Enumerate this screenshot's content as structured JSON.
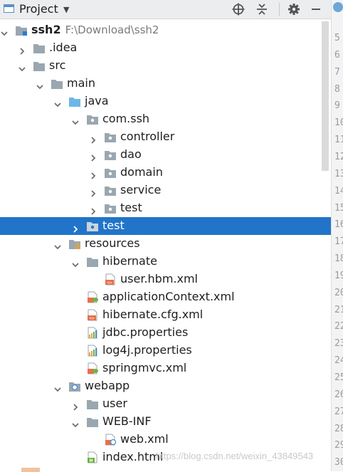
{
  "header": {
    "title": "Project",
    "icons": [
      "project-view-icon",
      "dropdown-icon",
      "locate-icon",
      "collapse-all-icon",
      "gear-icon"
    ]
  },
  "gutter": {
    "line_numbers": [
      "5",
      "6",
      "7",
      "8",
      "9",
      "10",
      "11",
      "12",
      "13",
      "14",
      "15",
      "16",
      "17",
      "18",
      "19",
      "20",
      "21",
      "22",
      "23",
      "24",
      "25",
      "26",
      "27",
      "28",
      "29",
      "30"
    ]
  },
  "tree": [
    {
      "depth": 0,
      "arrow": "down",
      "icon": "module",
      "label": "ssh2",
      "extra": "F:\\Download\\ssh2",
      "bold": true
    },
    {
      "depth": 1,
      "arrow": "right",
      "icon": "folder-gray",
      "label": ".idea"
    },
    {
      "depth": 1,
      "arrow": "down",
      "icon": "folder-gray",
      "label": "src"
    },
    {
      "depth": 2,
      "arrow": "down",
      "icon": "folder-gray",
      "label": "main"
    },
    {
      "depth": 3,
      "arrow": "down",
      "icon": "folder-blue",
      "label": "java"
    },
    {
      "depth": 4,
      "arrow": "down",
      "icon": "package",
      "label": "com.ssh"
    },
    {
      "depth": 5,
      "arrow": "right",
      "icon": "package",
      "label": "controller"
    },
    {
      "depth": 5,
      "arrow": "right",
      "icon": "package",
      "label": "dao"
    },
    {
      "depth": 5,
      "arrow": "right",
      "icon": "package",
      "label": "domain"
    },
    {
      "depth": 5,
      "arrow": "right",
      "icon": "package",
      "label": "service"
    },
    {
      "depth": 5,
      "arrow": "right",
      "icon": "package",
      "label": "test"
    },
    {
      "depth": 4,
      "arrow": "right",
      "icon": "package",
      "label": "test",
      "selected": true
    },
    {
      "depth": 3,
      "arrow": "down",
      "icon": "folder-resources",
      "label": "resources"
    },
    {
      "depth": 4,
      "arrow": "down",
      "icon": "folder-gray",
      "label": "hibernate"
    },
    {
      "depth": 5,
      "arrow": "none",
      "icon": "xml",
      "label": "user.hbm.xml"
    },
    {
      "depth": 4,
      "arrow": "none",
      "icon": "spring-xml",
      "label": "applicationContext.xml"
    },
    {
      "depth": 4,
      "arrow": "none",
      "icon": "xml",
      "label": "hibernate.cfg.xml"
    },
    {
      "depth": 4,
      "arrow": "none",
      "icon": "properties",
      "label": "jdbc.properties"
    },
    {
      "depth": 4,
      "arrow": "none",
      "icon": "properties",
      "label": "log4j.properties"
    },
    {
      "depth": 4,
      "arrow": "none",
      "icon": "spring-xml",
      "label": "springmvc.xml"
    },
    {
      "depth": 3,
      "arrow": "down",
      "icon": "folder-web",
      "label": "webapp"
    },
    {
      "depth": 4,
      "arrow": "right",
      "icon": "folder-gray",
      "label": "user"
    },
    {
      "depth": 4,
      "arrow": "down",
      "icon": "folder-gray",
      "label": "WEB-INF"
    },
    {
      "depth": 5,
      "arrow": "none",
      "icon": "web-xml",
      "label": "web.xml"
    },
    {
      "depth": 4,
      "arrow": "none",
      "icon": "html",
      "label": "index.html"
    }
  ],
  "watermark": "https://blog.csdn.net/weixin_43849543"
}
